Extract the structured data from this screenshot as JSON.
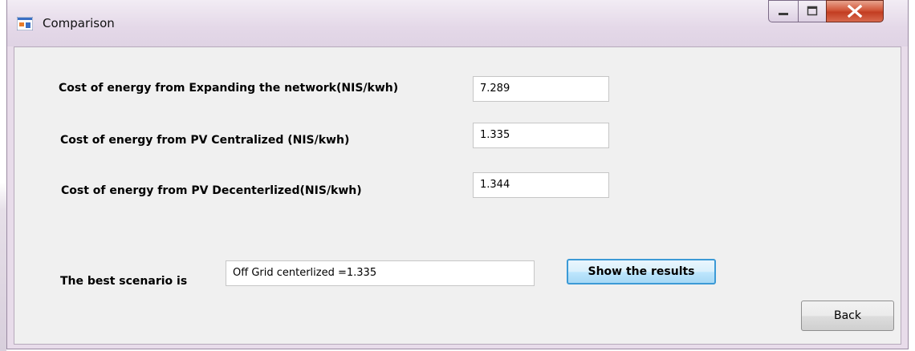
{
  "window": {
    "title": "Comparison"
  },
  "title_bar_buttons": {
    "minimize": "minimize-icon",
    "maximize": "maximize-icon",
    "close": "close-icon"
  },
  "form": {
    "expanding_label": "Cost of energy from Expanding the network(NIS/kwh)",
    "expanding_value": "7.289",
    "pv_centralized_label": "Cost of energy from PV Centralized (NIS/kwh)",
    "pv_centralized_value": "1.335",
    "pv_decentralized_label": "Cost of energy from PV Decenterlized(NIS/kwh)",
    "pv_decentralized_value": "1.344",
    "best_label": "The best scenario is",
    "best_value": "Off Grid centerlized =1.335",
    "show_results_label": "Show the results",
    "back_label": "Back"
  },
  "colors": {
    "close_button": "#c94a2e",
    "focus_border": "#3c9ad6",
    "client_background": "#f0f0f0"
  }
}
